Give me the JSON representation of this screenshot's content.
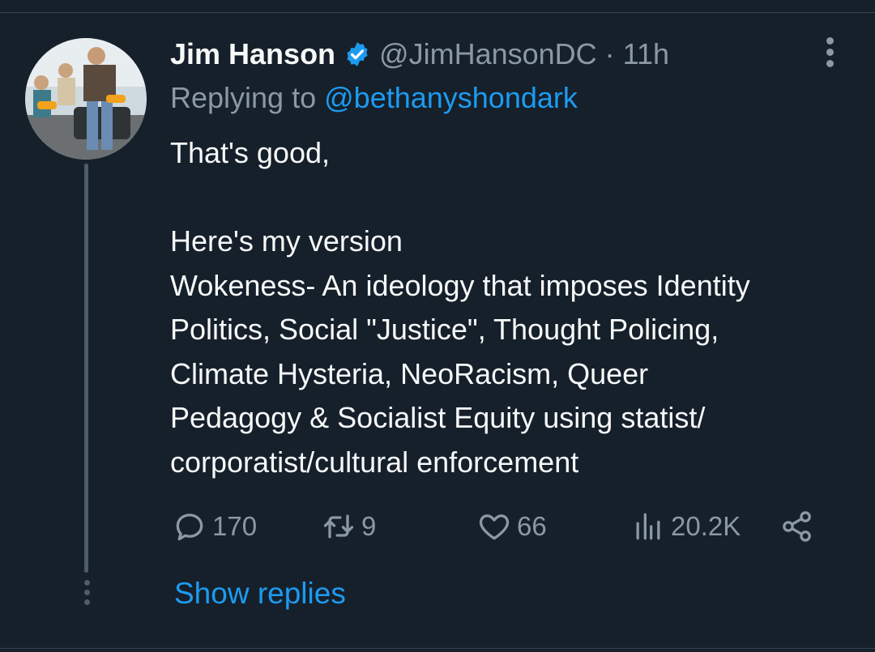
{
  "tweet": {
    "author_name": "Jim Hanson",
    "handle": "@JimHansonDC",
    "separator": "·",
    "time": "11h",
    "replying_prefix": "Replying to",
    "replying_to": "@bethanyshondark",
    "text": "That's good,\n\nHere's my version\nWokeness- An ideology that imposes Identity\nPolitics, Social \"Justice\", Thought Policing,\nClimate Hysteria, NeoRacism, Queer\nPedagogy & Socialist Equity using statist/\ncorporatist/cultural enforcement"
  },
  "actions": {
    "replies": "170",
    "retweets": "9",
    "likes": "66",
    "views": "20.2K"
  },
  "show_replies_label": "Show replies",
  "colors": {
    "background": "#15202b",
    "text_primary": "#f7f9f9",
    "text_secondary": "#8b98a5",
    "accent": "#1d9bf0",
    "thread_line": "#4d5d6b"
  },
  "icons": {
    "verified": "verified-badge-icon",
    "more": "more-vertical-icon",
    "reply": "comment-icon",
    "retweet": "retweet-icon",
    "like": "heart-icon",
    "views": "views-bar-chart-icon",
    "share": "share-icon"
  }
}
